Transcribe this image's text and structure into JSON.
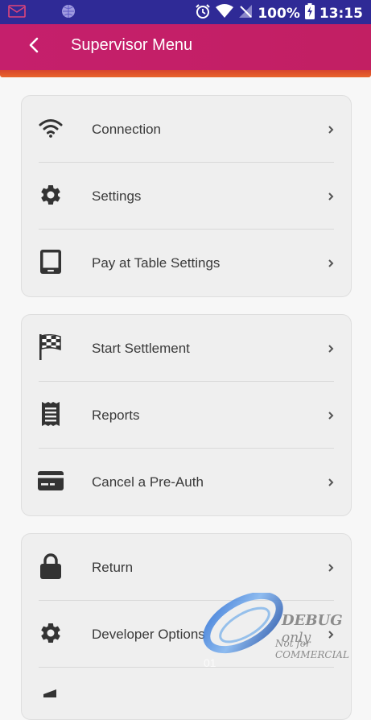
{
  "status_bar": {
    "battery_percent": "100%",
    "time": "13:15",
    "icons": [
      "notification-mail-icon",
      "notification-globe-icon",
      "alarm-icon",
      "wifi-icon",
      "no-signal-icon",
      "battery-charging-icon"
    ]
  },
  "app_bar": {
    "title": "Supervisor Menu",
    "back_icon": "chevron-left-icon"
  },
  "groups": [
    {
      "items": [
        {
          "label": "Connection",
          "icon": "wifi-icon"
        },
        {
          "label": "Settings",
          "icon": "gear-icon"
        },
        {
          "label": "Pay at Table Settings",
          "icon": "tablet-icon"
        }
      ]
    },
    {
      "items": [
        {
          "label": "Start Settlement",
          "icon": "checkered-flag-icon"
        },
        {
          "label": "Reports",
          "icon": "receipt-icon"
        },
        {
          "label": "Cancel a Pre-Auth",
          "icon": "credit-card-icon"
        }
      ]
    },
    {
      "items": [
        {
          "label": "Return",
          "icon": "lock-icon"
        },
        {
          "label": "Developer Options",
          "icon": "gear-icon"
        },
        {
          "label": "",
          "icon": "partial-icon"
        }
      ]
    }
  ],
  "watermark": {
    "debug": "DEBUG",
    "only": "only",
    "not_for": "Not for COMMERCIAL",
    "code": "01"
  },
  "colors": {
    "status_bar": "#2f2a96",
    "app_bar": "#c21f63",
    "accent_strip": "#e8652b",
    "card_bg": "#efefef",
    "icon": "#333333"
  }
}
